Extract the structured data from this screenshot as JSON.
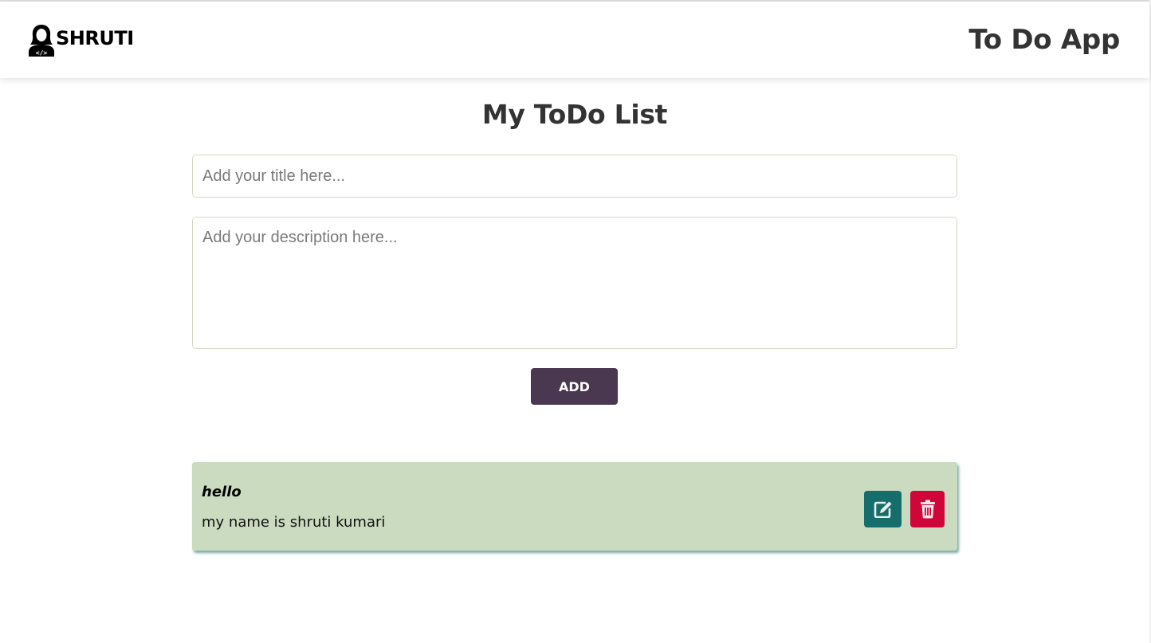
{
  "header": {
    "brand_text": "SHRUTI",
    "brand_icon": "developer-avatar-icon",
    "app_title": "To Do App"
  },
  "main": {
    "heading": "My ToDo List",
    "title_input": {
      "value": "",
      "placeholder": "Add your title here..."
    },
    "description_input": {
      "value": "",
      "placeholder": "Add your description here..."
    },
    "add_button_label": "ADD"
  },
  "todos": [
    {
      "title": "hello",
      "description": "my name is shruti kumari",
      "edit_icon": "edit-icon",
      "delete_icon": "trash-icon"
    }
  ],
  "colors": {
    "add_button": "#4a3850",
    "todo_card": "#cadbc0",
    "edit_button": "#156d6c",
    "delete_button": "#d0063a"
  }
}
